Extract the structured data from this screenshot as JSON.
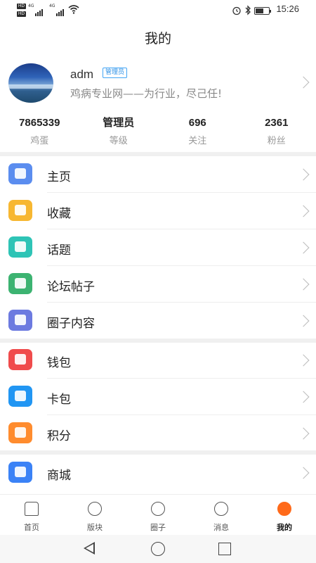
{
  "status_bar": {
    "hd_label": "HD",
    "net_label": "4G",
    "time": "15:26",
    "battery_level": 0.6,
    "icons": [
      "alarm-icon",
      "bluetooth-icon",
      "battery-icon",
      "wifi-icon"
    ]
  },
  "page_title": "我的",
  "profile": {
    "username": "adm",
    "role_badge": "管理员",
    "signature": "鸡病专业网——为行业，尽己任!"
  },
  "stats": [
    {
      "value": "7865339",
      "label": "鸡蛋"
    },
    {
      "value": "管理员",
      "label": "等级"
    },
    {
      "value": "696",
      "label": "关注"
    },
    {
      "value": "2361",
      "label": "粉丝"
    }
  ],
  "menu": [
    {
      "label": "主页",
      "icon": "picture-icon",
      "color": "#5b8def"
    },
    {
      "label": "收藏",
      "icon": "box-icon",
      "color": "#f7b731"
    },
    {
      "label": "话题",
      "icon": "hashtag-chat-icon",
      "color": "#2ec4b6"
    },
    {
      "label": "论坛帖子",
      "icon": "chat-bubbles-icon",
      "color": "#3cb371"
    },
    {
      "label": "圈子内容",
      "icon": "spiral-icon",
      "color": "#6c7ae0"
    },
    {
      "label": "钱包",
      "icon": "wallet-icon",
      "color": "#f04b4c"
    },
    {
      "label": "卡包",
      "icon": "card-icon",
      "color": "#2196f3"
    },
    {
      "label": "积分",
      "icon": "coins-icon",
      "color": "#ff8c2e"
    },
    {
      "label": "商城",
      "icon": "store-icon",
      "color": "#3b82f6"
    }
  ],
  "tabs": [
    {
      "label": "首页",
      "icon": "home-icon"
    },
    {
      "label": "版块",
      "icon": "hexagon-icon"
    },
    {
      "label": "圈子",
      "icon": "circle-icon"
    },
    {
      "label": "消息",
      "icon": "message-icon"
    },
    {
      "label": "我的",
      "icon": "profile-icon",
      "active": true
    }
  ]
}
